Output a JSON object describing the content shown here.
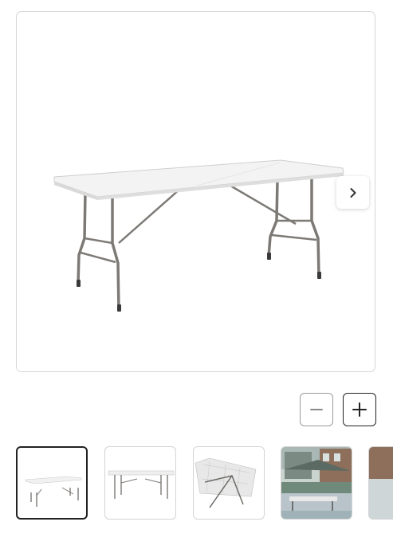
{
  "gallery": {
    "main_image": "folding-table-product-photo",
    "next_icon": "chevron-right-icon",
    "zoom_out_icon": "minus-icon",
    "zoom_in_icon": "plus-icon",
    "thumbnails": [
      {
        "image": "folding-table-angled-view",
        "selected": true
      },
      {
        "image": "folding-table-side-view",
        "selected": false
      },
      {
        "image": "folding-table-underside-view",
        "selected": false
      },
      {
        "image": "folding-table-outdoor-scene",
        "selected": false
      },
      {
        "image": "folding-table-partial-thumbnail",
        "selected": false
      }
    ]
  },
  "colors": {
    "border": "#d6d6d6",
    "active_border": "#222222",
    "table_top": "#f2f2f2",
    "table_legs": "#7d7a76"
  }
}
